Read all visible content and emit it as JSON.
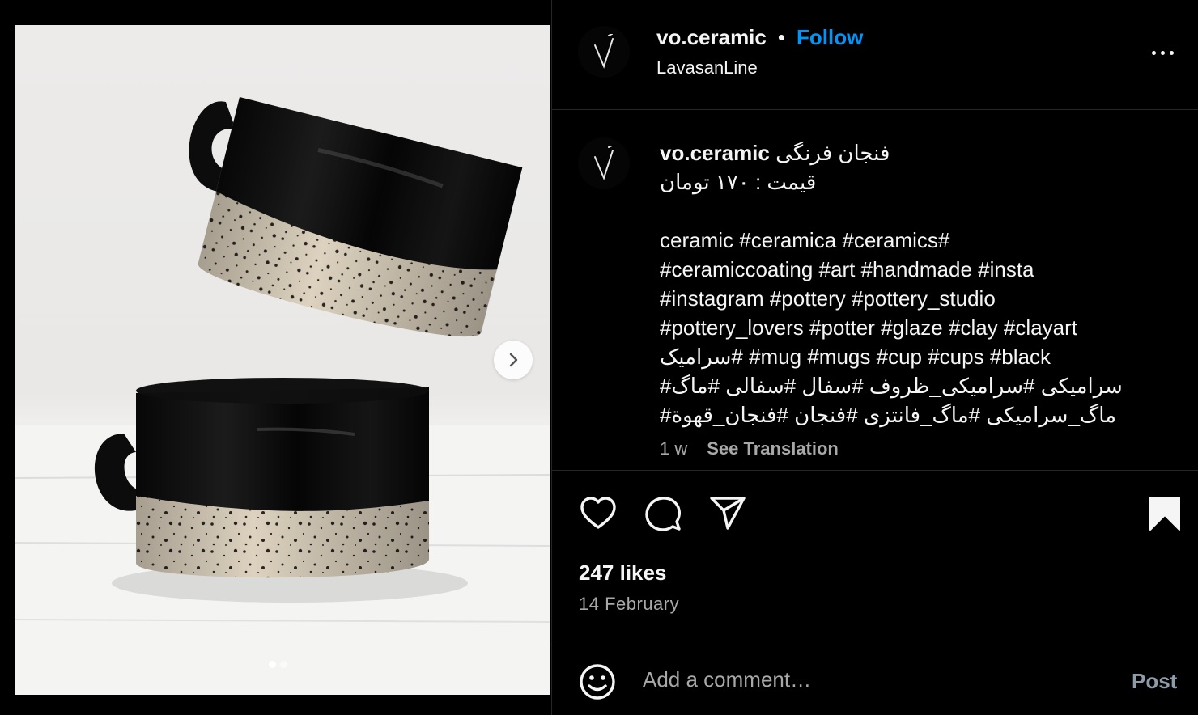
{
  "post": {
    "username": "vo.ceramic",
    "separator": "•",
    "follow_label": "Follow",
    "location": "LavasanLine",
    "more_icon": "more-horizontal-icon",
    "avatar_glyph": "V"
  },
  "media": {
    "image_alt": "Two stacked black-glazed speckled ceramic mugs on a white table",
    "slide_count": 2,
    "active_slide": 1,
    "next_icon": "chevron-right-icon"
  },
  "caption": {
    "username": "vo.ceramic",
    "title": "فنجان فرنگی",
    "price": "قیمت : ۱۷۰ تومان",
    "hashtag_lines": [
      "ceramic #ceramica #ceramics#",
      "#ceramiccoating #art #handmade #insta",
      "#instagram #pottery #pottery_studio",
      "#pottery_lovers #potter #glaze #clay #clayart",
      "سرامیک# #mug #mugs #cup #cups #black",
      "#سرامیکی #سرامیکی_ظروف #سفال #سفالی #ماگ",
      "#ماگ_سرامیکی #ماگ_فانتزی #فنجان #فنجان_قهوة"
    ],
    "age": "1 w",
    "see_translation": "See Translation"
  },
  "actions": {
    "like_icon": "heart-icon",
    "comment_icon": "comment-icon",
    "share_icon": "paper-plane-icon",
    "save_icon": "bookmark-icon",
    "saved": true
  },
  "stats": {
    "likes": "247 likes",
    "date": "14 February"
  },
  "comment": {
    "emoji_icon": "emoji-smile-icon",
    "placeholder": "Add a comment…",
    "value": "",
    "post_label": "Post"
  },
  "colors": {
    "background": "#000000",
    "text": "#f5f5f5",
    "secondary_text": "#a8a8a8",
    "link_blue": "#0095f6",
    "divider": "#262626",
    "post_disabled": "#8e9caa"
  }
}
